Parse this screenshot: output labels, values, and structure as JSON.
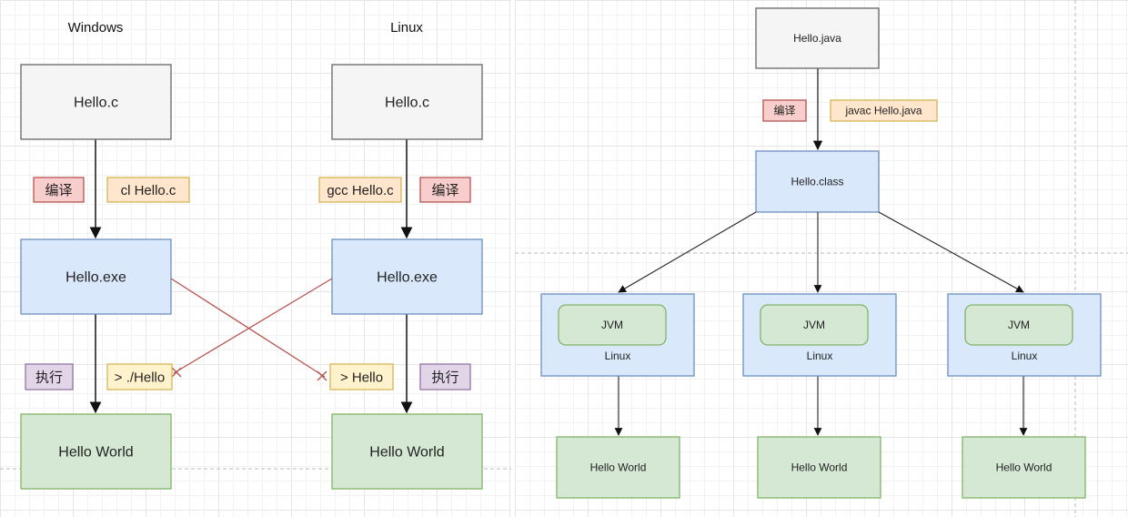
{
  "left": {
    "headings": [
      "Windows",
      "Linux"
    ],
    "windows": {
      "source": "Hello.c",
      "compile_tag": "编译",
      "compile_cmd": "cl Hello.c",
      "binary": "Hello.exe",
      "run_tag": "执行",
      "run_cmd": "> ./Hello",
      "output": "Hello World"
    },
    "linux": {
      "source": "Hello.c",
      "compile_tag": "编译",
      "compile_cmd": "gcc Hello.c",
      "binary": "Hello.exe",
      "run_tag": "执行",
      "run_cmd": "> Hello",
      "output": "Hello World"
    }
  },
  "right": {
    "source": "Hello.java",
    "compile_tag": "编译",
    "compile_cmd": "javac Hello.java",
    "bytecode": "Hello.class",
    "platforms": [
      {
        "vm": "JVM",
        "os": "Linux",
        "output": "Hello World"
      },
      {
        "vm": "JVM",
        "os": "Linux",
        "output": "Hello World"
      },
      {
        "vm": "JVM",
        "os": "Linux",
        "output": "Hello World"
      }
    ]
  },
  "colors": {
    "gray_fill": "#f5f5f5",
    "gray_stroke": "#666666",
    "blue_fill": "#dae8fc",
    "blue_stroke": "#6c8ebf",
    "green_fill": "#d5e8d4",
    "green_stroke": "#82b366",
    "red_fill": "#f8cecc",
    "red_stroke": "#b85450",
    "yellow_fill": "#ffe6cc",
    "yellow_stroke": "#d6b656",
    "purple_fill": "#e1d5e7",
    "purple_stroke": "#9673a6",
    "cross_line": "#b85450"
  }
}
